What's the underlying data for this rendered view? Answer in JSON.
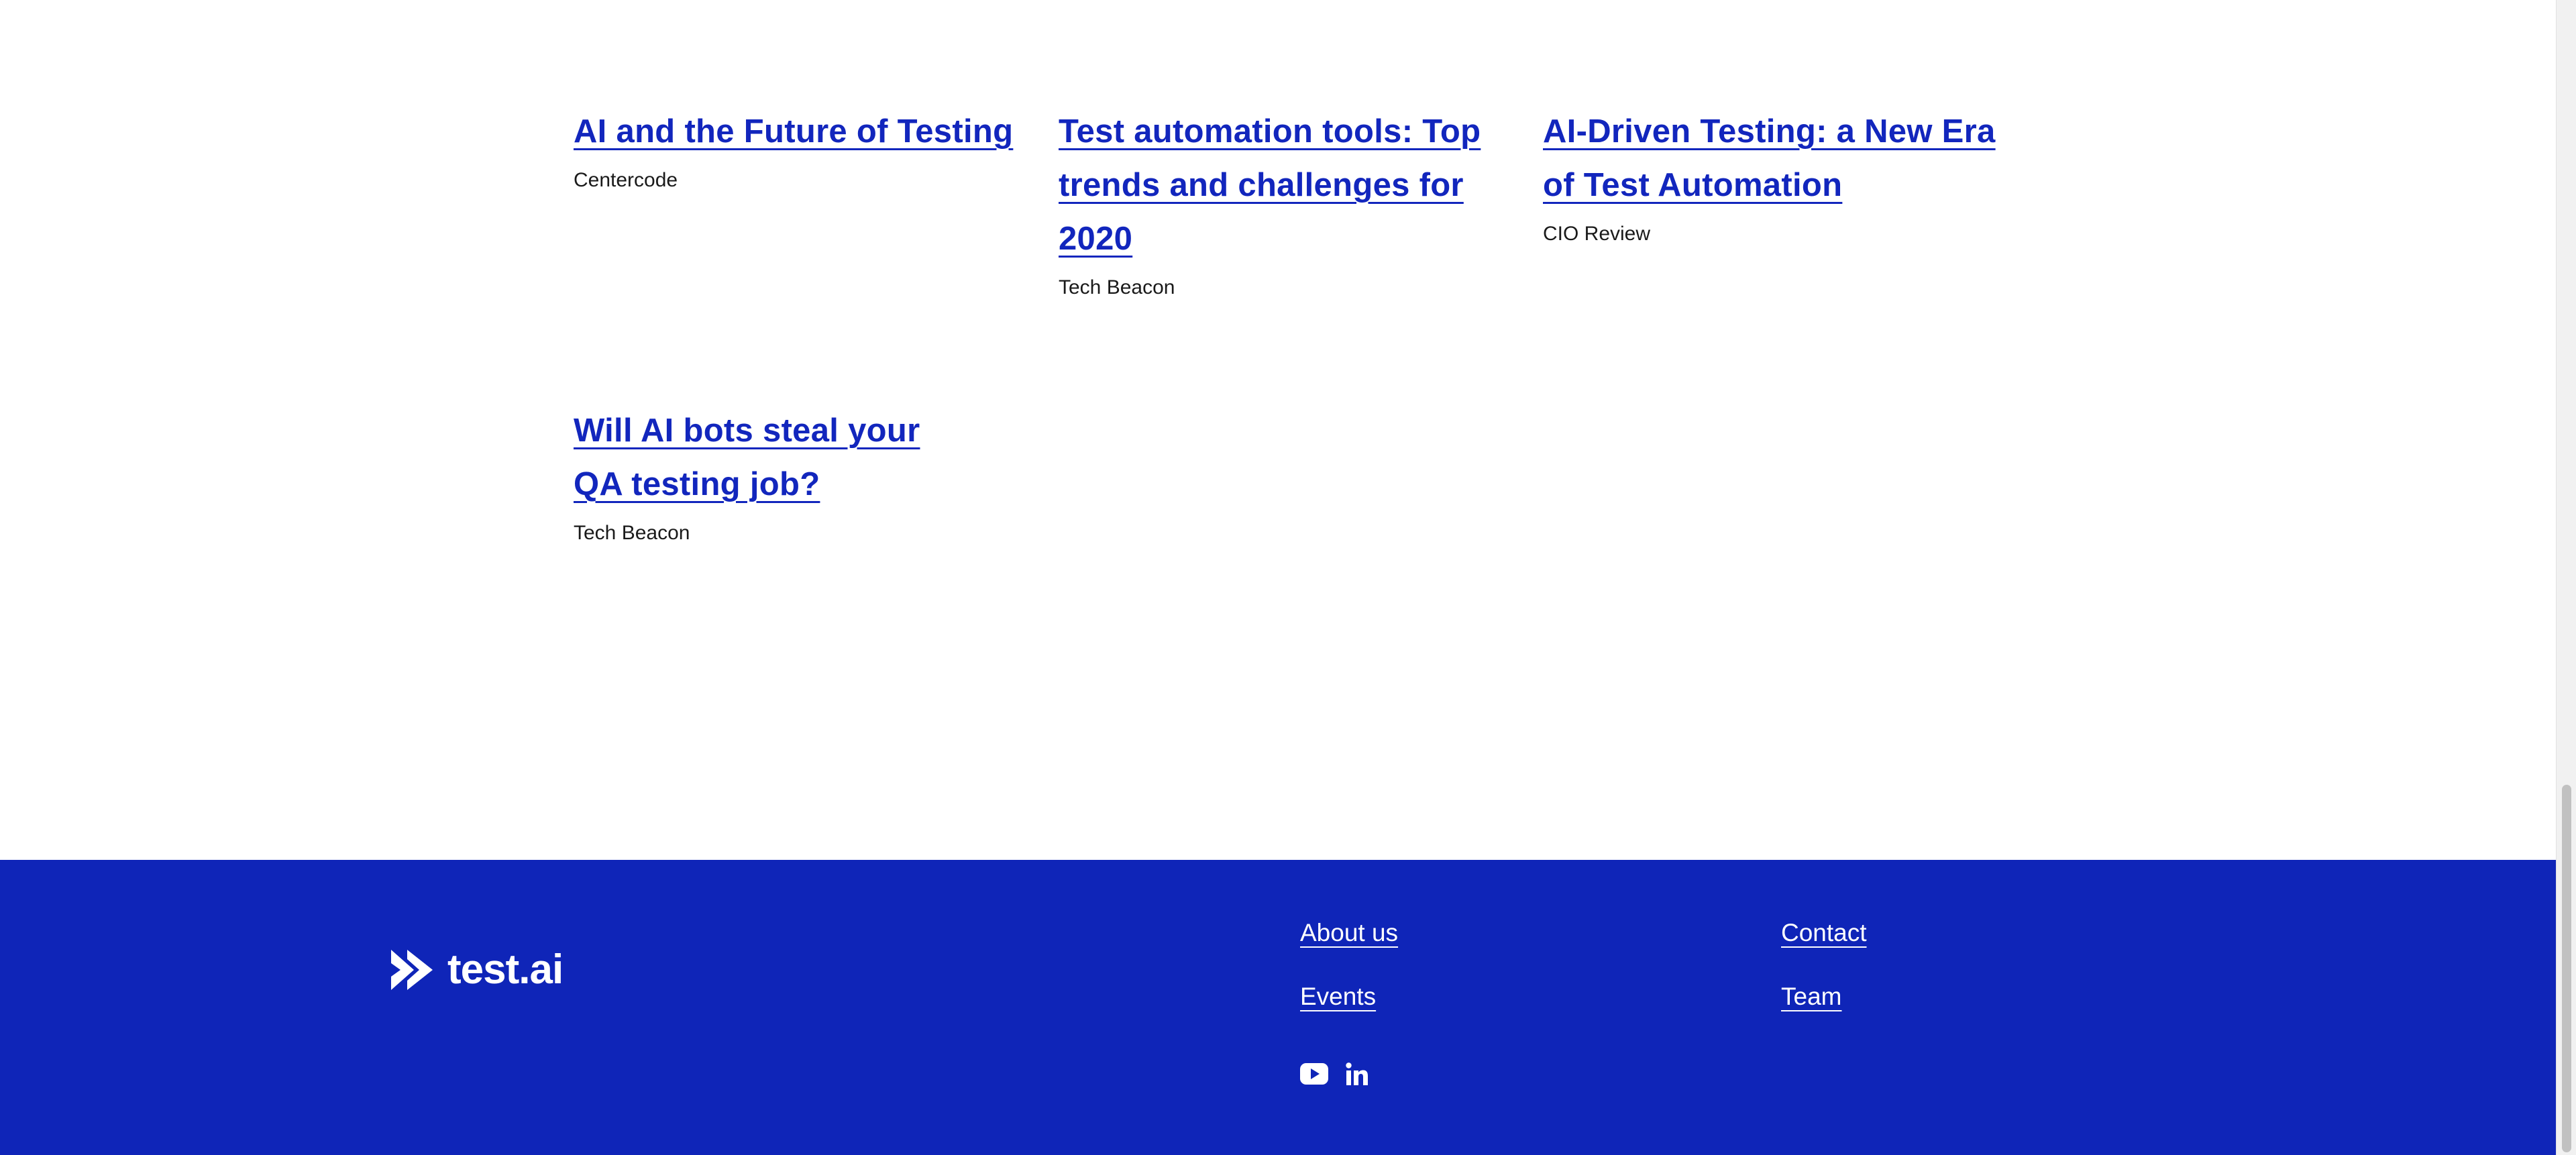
{
  "articles": [
    {
      "title": "AI and the Future of Testing",
      "source": "Centercode"
    },
    {
      "title": "Test automation tools: Top trends and challenges for 2020",
      "source": "Tech Beacon"
    },
    {
      "title": "AI-Driven Testing: a New Era of Test Automation",
      "source": "CIO Review"
    },
    {
      "title": "Will AI bots steal your QA testing job?",
      "source": "Tech Beacon"
    }
  ],
  "footer": {
    "logo_text": "test.ai",
    "links": {
      "about": "About us",
      "events": "Events",
      "contact": "Contact",
      "team": "Team"
    },
    "social": [
      "youtube-icon",
      "linkedin-icon"
    ]
  },
  "colors": {
    "link": "#1226bd",
    "footer_bg": "#0f25b8",
    "text": "#1a1a1a"
  }
}
